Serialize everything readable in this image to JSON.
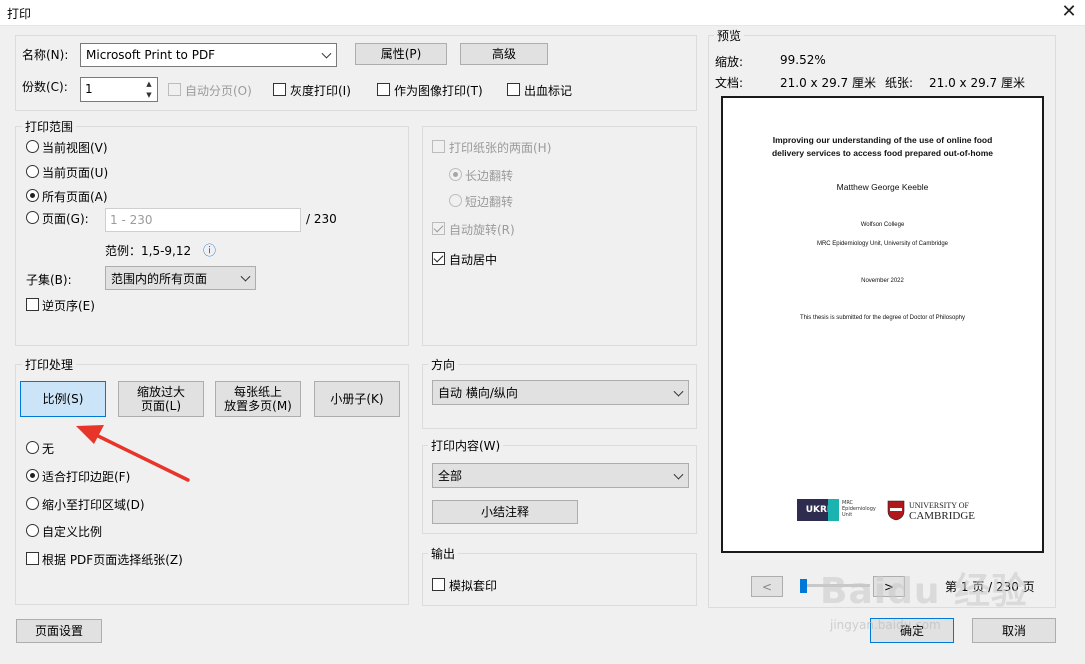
{
  "window": {
    "title": "打印",
    "close_glyph": "✕"
  },
  "printer": {
    "name_label": "名称(N):",
    "name_value": "Microsoft Print to PDF",
    "properties_btn": "属性(P)",
    "advanced_btn": "高级",
    "copies_label": "份数(C):",
    "copies_value": "1",
    "collate_label": "自动分页(O)",
    "grayscale_label": "灰度打印(I)",
    "as_image_label": "作为图像打印(T)",
    "bleed_label": "出血标记"
  },
  "range": {
    "title": "打印范围",
    "current_view": "当前视图(V)",
    "current_page": "当前页面(U)",
    "all_pages": "所有页面(A)",
    "pages": "页面(G):",
    "pages_placeholder": "1 - 230",
    "pages_total": "/ 230",
    "example": "范例：1,5-9,12",
    "info_icon": "ⓘ",
    "subset_label": "子集(B):",
    "subset_value": "范围内的所有页面",
    "reverse_label": "逆页序(E)"
  },
  "duplex": {
    "both_sides": "打印纸张的两面(H)",
    "long_edge": "长边翻转",
    "short_edge": "短边翻转",
    "auto_rotate": "自动旋转(R)",
    "auto_center": "自动居中"
  },
  "handling": {
    "title": "打印处理",
    "btn_scale": "比例(S)",
    "btn_fit_line1": "缩放过大",
    "btn_fit_line2": "页面(L)",
    "btn_multi_line1": "每张纸上",
    "btn_multi_line2": "放置多页(M)",
    "btn_booklet": "小册子(K)",
    "opt_none": "无",
    "opt_fit_margins": "适合打印边距(F)",
    "opt_shrink": "缩小至打印区域(D)",
    "opt_custom": "自定义比例",
    "opt_choose_paper": "根据 PDF页面选择纸张(Z)"
  },
  "orientation": {
    "title": "方向",
    "value": "自动 横向/纵向"
  },
  "content": {
    "title": "打印内容(W)",
    "value": "全部",
    "summary_btn": "小结注释"
  },
  "output": {
    "title": "输出",
    "simulate": "模拟套印"
  },
  "preview": {
    "title": "预览",
    "zoom_label": "缩放:",
    "zoom_value": "99.52%",
    "doc_label": "文档:",
    "doc_value": "21.0 x 29.7 厘米",
    "paper_label": "纸张:",
    "paper_value": "21.0 x 29.7 厘米",
    "page_indicator": "第 1 页 / 230 页",
    "prev": "<",
    "next": ">",
    "doc_title_1": "Improving our understanding of the use of online food",
    "doc_title_2": "delivery services to access food prepared out-of-home",
    "doc_author": "Matthew George Keeble",
    "doc_college": "Wolfson College",
    "doc_unit": "MRC Epidemiology Unit, University of Cambridge",
    "doc_date": "November 2022",
    "doc_degree": "This thesis is submitted for the degree of Doctor of Philosophy",
    "logo_ukri": "UKRI",
    "logo_mrc_1": "MRC",
    "logo_mrc_2": "Epidemiology",
    "logo_mrc_3": "Unit",
    "logo_cam_1": "UNIVERSITY OF",
    "logo_cam_2": "CAMBRIDGE"
  },
  "footer": {
    "page_setup": "页面设置",
    "ok": "确定",
    "cancel": "取消"
  },
  "watermark": {
    "text": "Baidu 经验",
    "url": "jingyan.baidu.com"
  }
}
